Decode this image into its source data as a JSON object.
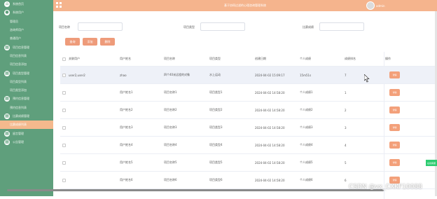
{
  "app": {
    "title": "基于协同过滤的心理咨询管理系统",
    "user": "admin"
  },
  "sidebar": {
    "items": [
      {
        "label": "系统首页",
        "type": "group",
        "icon": "home-icon",
        "glyph": "⌂"
      },
      {
        "label": "系统用户",
        "type": "group",
        "icon": "user-icon",
        "glyph": "●"
      },
      {
        "label": "管理员",
        "type": "sub"
      },
      {
        "label": "咨询师用户",
        "type": "sub"
      },
      {
        "label": "普通用户",
        "type": "sub"
      },
      {
        "label": "项目信息管理",
        "type": "group",
        "icon": "grid-icon",
        "glyph": "▦"
      },
      {
        "label": "项目信息列表",
        "type": "sub"
      },
      {
        "label": "项目信息添加",
        "type": "sub"
      },
      {
        "label": "项目类型管理",
        "type": "group",
        "icon": "grid-icon",
        "glyph": "▦"
      },
      {
        "label": "项目类型列表",
        "type": "sub"
      },
      {
        "label": "项目类型添加",
        "type": "sub"
      },
      {
        "label": "预约信息管理",
        "type": "group",
        "icon": "grid-icon",
        "glyph": "▦"
      },
      {
        "label": "预约信息列表",
        "type": "sub"
      },
      {
        "label": "比赛成绩管理",
        "type": "group",
        "icon": "grid-icon",
        "glyph": "▦"
      },
      {
        "label": "比赛成绩列表",
        "type": "sub",
        "active": true
      },
      {
        "label": "留言管理",
        "type": "group",
        "icon": "grid-icon",
        "glyph": "▦"
      },
      {
        "label": "公告管理",
        "type": "group",
        "icon": "grid-icon",
        "glyph": "▦"
      }
    ]
  },
  "filters": {
    "name_label": "项目名称",
    "type_label": "项目类型",
    "score_label": "比赛成绩"
  },
  "buttons": {
    "search": "查询",
    "add": "添加",
    "delete": "删除"
  },
  "table": {
    "columns": [
      "关联用户",
      "用户姓名",
      "项目名称",
      "项目类型",
      "创建日期",
      "个人成绩",
      "成绩排名",
      "操作"
    ],
    "action_label": "详情",
    "rows": [
      [
        "user2,user2",
        "zhao",
        "四个40米远程的对象",
        "水上运动",
        "2024-04-02 15:09:17",
        "15m51s",
        "7"
      ],
      [
        "",
        "用户姓名1",
        "项目名称1",
        "项目类型1",
        "2024-04-02 14:58:20",
        "个人成绩1",
        "1"
      ],
      [
        "",
        "用户姓名2",
        "项目名称2",
        "项目类型2",
        "2024-04-02 14:58:20",
        "个人成绩2",
        "2"
      ],
      [
        "",
        "用户姓名3",
        "项目名称3",
        "项目类型3",
        "2024-04-02 14:58:20",
        "个人成绩3",
        "3"
      ],
      [
        "",
        "用户姓名4",
        "项目名称4",
        "项目类型4",
        "2024-04-02 14:58:20",
        "个人成绩4",
        "4"
      ],
      [
        "",
        "用户姓名5",
        "项目名称5",
        "项目类型5",
        "2024-04-02 14:58:20",
        "个人成绩5",
        "5"
      ],
      [
        "",
        "用户姓名6",
        "项目名称6",
        "项目类型6",
        "2024-04-02 14:58:20",
        "个人成绩6",
        "6"
      ]
    ]
  },
  "floating_button": "在线客服",
  "watermark": "CSDN @vx_CXKF10088",
  "colors": {
    "sidebar": "#5f9f7c",
    "accent": "#f5b48d",
    "button": "#ee9b7a"
  }
}
